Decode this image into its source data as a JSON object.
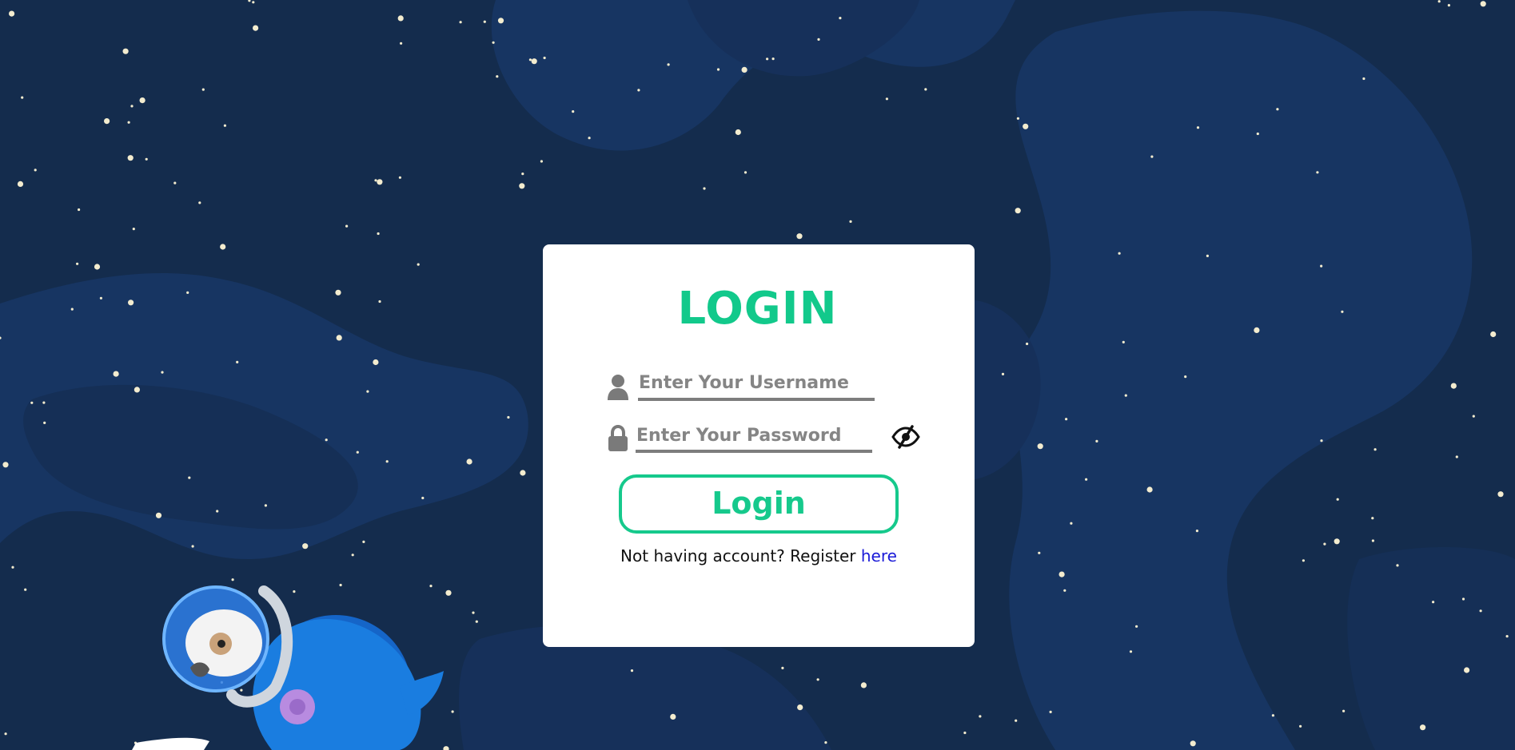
{
  "background": {
    "color": "#142c4d",
    "blob_color": "#173562",
    "star_color": "#f3eccf",
    "mascot": "astronaut-dog-illustration"
  },
  "login": {
    "title": "LOGIN",
    "username_placeholder": "Enter Your Username",
    "password_placeholder": "Enter Your Password",
    "button_label": "Login",
    "register_prompt": "Not having account? Register",
    "register_link": "here",
    "accent_color": "#12c98b"
  },
  "icons": {
    "username": "user-icon",
    "password": "lock-icon",
    "toggle": "eye-slash-icon"
  }
}
